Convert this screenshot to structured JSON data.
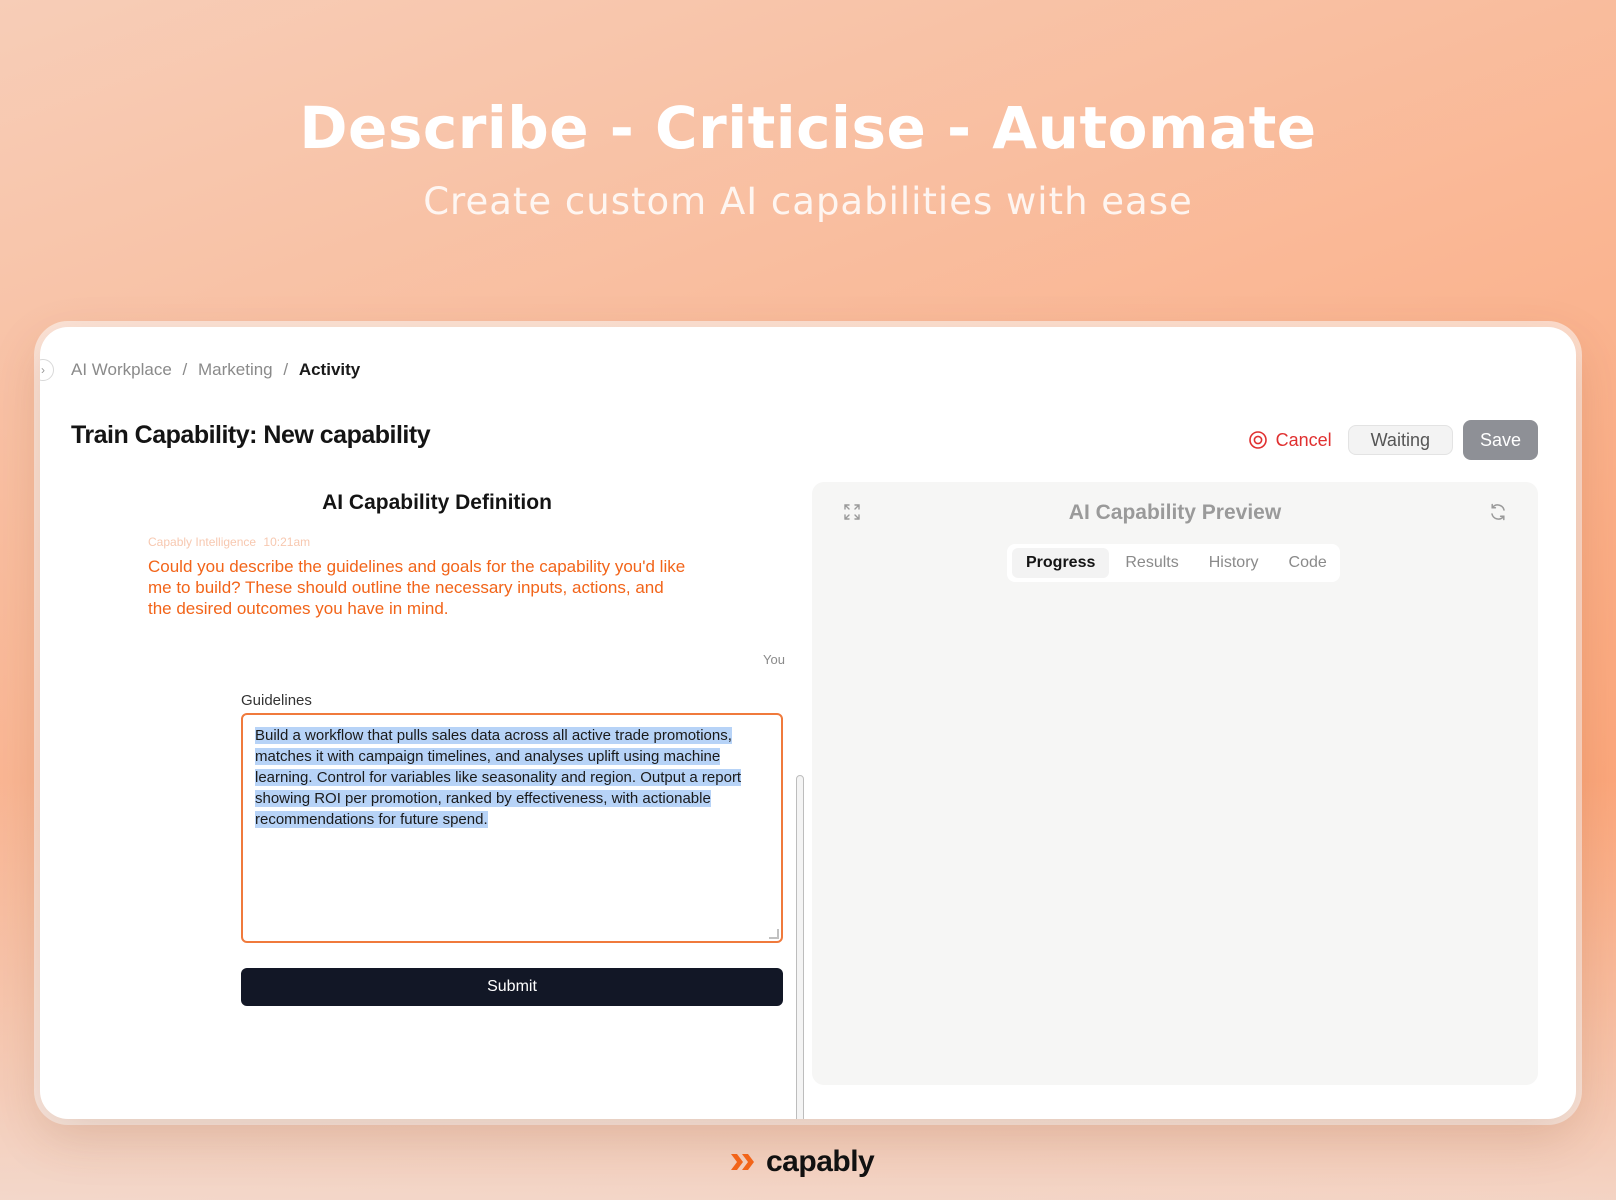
{
  "hero": {
    "title": "Describe - Criticise - Automate",
    "subtitle": "Create custom AI capabilities with ease"
  },
  "breadcrumb": {
    "items": [
      "AI Workplace",
      "Marketing",
      "Activity"
    ],
    "separator": "/"
  },
  "page": {
    "title": "Train Capability: New capability"
  },
  "actions": {
    "cancel_label": "Cancel",
    "waiting_label": "Waiting",
    "save_label": "Save"
  },
  "definition": {
    "title": "AI Capability Definition",
    "ai_sender": "Capably Intelligence",
    "ai_time": "10:21am",
    "ai_message": "Could you describe the guidelines and goals for the capability you'd like me to build? These should outline the necessary inputs, actions, and the desired outcomes you have in mind.",
    "you_label": "You",
    "guidelines_label": "Guidelines",
    "guidelines_value": "Build a workflow that pulls sales data across all active trade promotions, matches it with campaign timelines, and analyses uplift using machine learning. Control for variables like seasonality and region. Output a report showing ROI per promotion, ranked by effectiveness, with actionable recommendations for future spend.",
    "submit_label": "Submit"
  },
  "preview": {
    "title": "AI Capability Preview",
    "tabs": [
      {
        "label": "Progress",
        "active": true
      },
      {
        "label": "Results",
        "active": false
      },
      {
        "label": "History",
        "active": false
      },
      {
        "label": "Code",
        "active": false
      }
    ]
  },
  "brand": {
    "name": "capably",
    "accent": "#f26419"
  },
  "icons": {
    "cancel": "stop-circle-icon",
    "expand": "expand-icon",
    "refresh": "refresh-icon",
    "toggle": "chevron-right-icon"
  }
}
